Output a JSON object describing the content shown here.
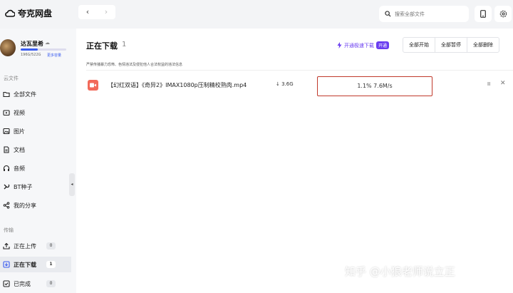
{
  "app": {
    "title": "夸克网盘"
  },
  "header": {
    "nav_back": "‹",
    "nav_forward": "›",
    "search_placeholder": "搜索全部文件"
  },
  "user": {
    "name": "达瓦里希",
    "storage": "196G/522G",
    "vip_link": "更多容量",
    "storage_used_fraction": 0.38
  },
  "sidebar": {
    "section_cloud": "云文件",
    "items": [
      {
        "label": "全部文件",
        "icon": "folder-icon"
      },
      {
        "label": "视频",
        "icon": "video-icon"
      },
      {
        "label": "图片",
        "icon": "image-icon"
      },
      {
        "label": "文档",
        "icon": "document-icon"
      },
      {
        "label": "音频",
        "icon": "headphones-icon"
      },
      {
        "label": "BT种子",
        "icon": "magnet-icon"
      },
      {
        "label": "我的分享",
        "icon": "share-icon"
      }
    ],
    "section_transfer": "传输",
    "transfer": [
      {
        "label": "正在上传",
        "count": "0",
        "icon": "upload-icon"
      },
      {
        "label": "正在下载",
        "count": "1",
        "icon": "download-icon",
        "active": true
      },
      {
        "label": "已完成",
        "count": "0",
        "icon": "done-icon"
      }
    ],
    "collapse": "◂"
  },
  "main": {
    "title": "正在下载",
    "count": "1",
    "speedup_label": "开通极速下载",
    "speedup_tag": "开通",
    "buttons": [
      "全部开始",
      "全部暂停",
      "全部删除"
    ],
    "notice": "严禁传播暴力恐怖、色情违法及侵犯他人合法权益的违法信息",
    "downloads": [
      {
        "name": "【幻红双语】《奇异2》IMAX1080p压制精校熟肉.mp4",
        "size": "3.6G",
        "progress": "1.1% 7.6M/s",
        "pause": "II",
        "close": "✕"
      }
    ]
  },
  "watermark": "知乎 @小狼老师说立正",
  "colors": {
    "accent": "#3a5cf0",
    "speedup": "#6a3df0",
    "file_icon": "#f26a5a",
    "highlight_box": "#c0392b"
  }
}
